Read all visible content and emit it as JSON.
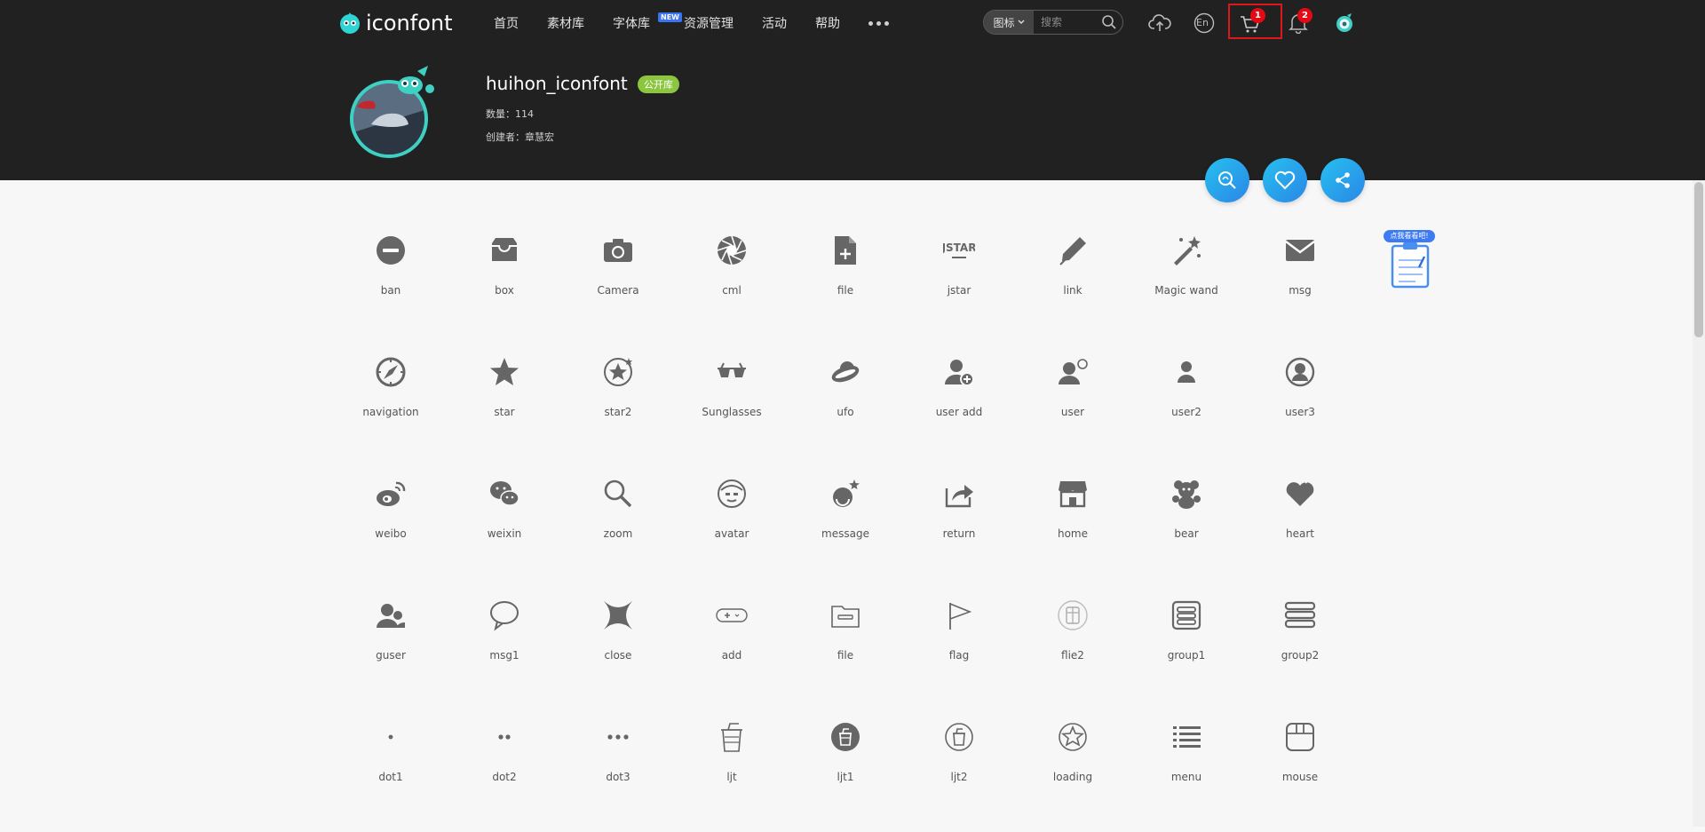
{
  "header": {
    "logo_text": "iconfont",
    "nav": [
      "首页",
      "素材库",
      "字体库",
      "资源管理",
      "活动",
      "帮助"
    ],
    "nav_new_badge": "NEW",
    "search_type": "图标",
    "search_placeholder": "搜索",
    "lang_label": "En",
    "cart_count": "1",
    "notification_count": "2"
  },
  "library": {
    "name": "huihon_iconfont",
    "visibility_badge": "公开库",
    "count_text": "数量：114",
    "creator_text": "创建者：章慧宏"
  },
  "float_ad": {
    "label": "点我看看吧!"
  },
  "icons": [
    {
      "name": "ban",
      "icon": "ban-icon"
    },
    {
      "name": "box",
      "icon": "box-icon"
    },
    {
      "name": "Camera",
      "icon": "camera-icon"
    },
    {
      "name": "cml",
      "icon": "aperture-icon"
    },
    {
      "name": "file",
      "icon": "file-add-icon"
    },
    {
      "name": "jstar",
      "icon": "jstar-icon"
    },
    {
      "name": "link",
      "icon": "pen-icon"
    },
    {
      "name": "Magic wand",
      "icon": "magic-wand-icon"
    },
    {
      "name": "msg",
      "icon": "mail-icon"
    },
    {
      "name": "navigation",
      "icon": "compass-icon"
    },
    {
      "name": "star",
      "icon": "star-icon"
    },
    {
      "name": "star2",
      "icon": "star-circle-icon"
    },
    {
      "name": "Sunglasses",
      "icon": "sunglasses-icon"
    },
    {
      "name": "ufo",
      "icon": "ufo-icon"
    },
    {
      "name": "user add",
      "icon": "user-add-icon"
    },
    {
      "name": "user",
      "icon": "user-chat-icon"
    },
    {
      "name": "user2",
      "icon": "user-small-icon"
    },
    {
      "name": "user3",
      "icon": "user-circle-icon"
    },
    {
      "name": "weibo",
      "icon": "weibo-icon"
    },
    {
      "name": "weixin",
      "icon": "wechat-icon"
    },
    {
      "name": "zoom",
      "icon": "zoom-icon"
    },
    {
      "name": "avatar",
      "icon": "avatar-face-icon"
    },
    {
      "name": "message",
      "icon": "message-bubble-icon"
    },
    {
      "name": "return",
      "icon": "return-arrow-icon"
    },
    {
      "name": "home",
      "icon": "shop-icon"
    },
    {
      "name": "bear",
      "icon": "bear-icon"
    },
    {
      "name": "heart",
      "icon": "heart-icon"
    },
    {
      "name": "guser",
      "icon": "group-user-icon"
    },
    {
      "name": "msg1",
      "icon": "speech-bubble-icon"
    },
    {
      "name": "close",
      "icon": "close-icon"
    },
    {
      "name": "add",
      "icon": "add-pill-icon"
    },
    {
      "name": "file",
      "icon": "folder-icon"
    },
    {
      "name": "flag",
      "icon": "flag-icon"
    },
    {
      "name": "flie2",
      "icon": "document-circle-icon"
    },
    {
      "name": "group1",
      "icon": "group-list-icon"
    },
    {
      "name": "group2",
      "icon": "group-stack-icon"
    },
    {
      "name": "dot1",
      "icon": "dot-one-icon"
    },
    {
      "name": "dot2",
      "icon": "dot-two-icon"
    },
    {
      "name": "dot3",
      "icon": "dot-three-icon"
    },
    {
      "name": "ljt",
      "icon": "trash-outline-icon"
    },
    {
      "name": "ljt1",
      "icon": "trash-filled-icon"
    },
    {
      "name": "ljt2",
      "icon": "trash-circle-icon"
    },
    {
      "name": "loading",
      "icon": "loading-icon"
    },
    {
      "name": "menu",
      "icon": "menu-icon"
    },
    {
      "name": "mouse",
      "icon": "mouse-icon"
    }
  ],
  "colors": {
    "header_bg": "#212121",
    "page_bg": "#f7f7f7",
    "icon_gray": "#666666",
    "accent_blue": "#2a86e6",
    "badge_green": "#8cc63f",
    "badge_red": "#e50914"
  }
}
